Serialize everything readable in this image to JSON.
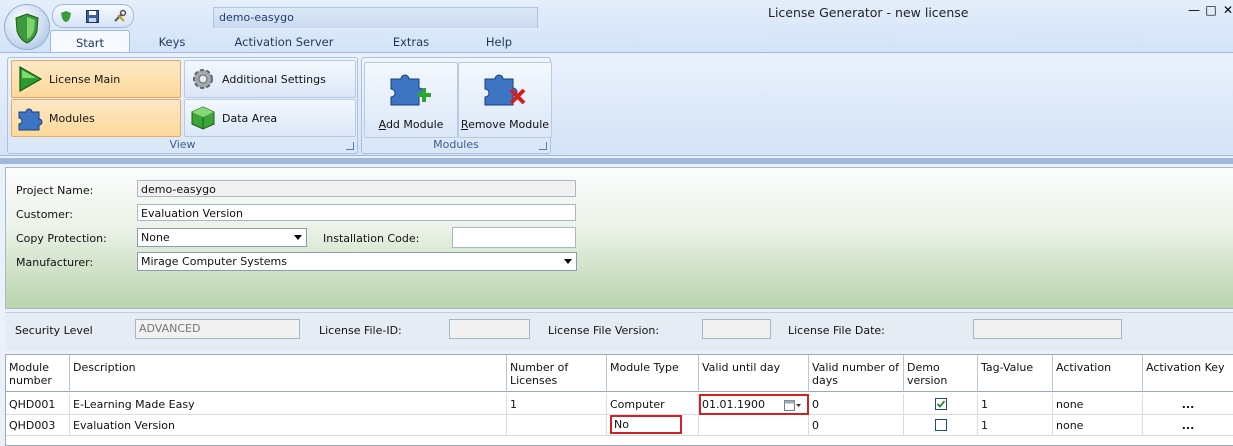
{
  "window": {
    "title": "License Generator - new license",
    "project_tab": "demo-easygo",
    "min_label": "—",
    "max_label": "□",
    "close_label": "✕"
  },
  "icons": [
    "shield-icon",
    "save-icon",
    "tools-icon",
    "play-icon",
    "gear-icon",
    "puzzle-icon",
    "data-cube-icon",
    "add-module-icon",
    "remove-module-icon",
    "calendar-icon",
    "checkmark-icon"
  ],
  "ribbon": {
    "tabs": [
      "Start",
      "Keys",
      "Activation Server",
      "Extras",
      "Help"
    ],
    "view_group": {
      "label": "View",
      "buttons": [
        "License Main",
        "Additional Settings",
        "Modules",
        "Data Area"
      ]
    },
    "modules_group": {
      "label": "Modules",
      "add_pre": "A",
      "add_rest": "dd Module",
      "remove_pre": "R",
      "remove_rest": "emove Module"
    }
  },
  "form": {
    "project_name_label": "Project Name:",
    "project_name_value": "demo-easygo",
    "customer_label": "Customer:",
    "customer_value": "Evaluation Version",
    "copy_protection_label": "Copy Protection:",
    "copy_protection_value": "None",
    "installation_code_label": "Installation Code:",
    "installation_code_value": "",
    "manufacturer_label": "Manufacturer:",
    "manufacturer_value": "Mirage Computer Systems"
  },
  "security": {
    "level_label": "Security Level",
    "level_value": "ADVANCED",
    "file_id_label": "License File-ID:",
    "file_id_value": "",
    "file_version_label": "License File Version:",
    "file_version_value": "",
    "file_date_label": "License File Date:",
    "file_date_value": ""
  },
  "grid": {
    "columns": [
      "Module number",
      "Description",
      "Number of Licenses",
      "Module Type",
      "Valid until day",
      "Valid number of days",
      "Demo version",
      "Tag-Value",
      "Activation",
      "Activation Key"
    ],
    "rows": [
      {
        "module": "QHD001",
        "description": "E-Learning Made Easy",
        "licenses": "1",
        "type": "Computer",
        "valid_until": "01.01.1900",
        "valid_days": "0",
        "demo": true,
        "tag": "1",
        "activation": "none",
        "key": "..."
      },
      {
        "module": "QHD003",
        "description": "Evaluation Version",
        "licenses": "",
        "type": "No",
        "valid_until": "",
        "valid_days": "0",
        "demo": false,
        "tag": "1",
        "activation": "none",
        "key": "..."
      }
    ]
  },
  "colors": {
    "accent_orange": "#fbd89a",
    "highlight_red": "#d42020",
    "ribbon_blue": "#d4e3f6"
  }
}
